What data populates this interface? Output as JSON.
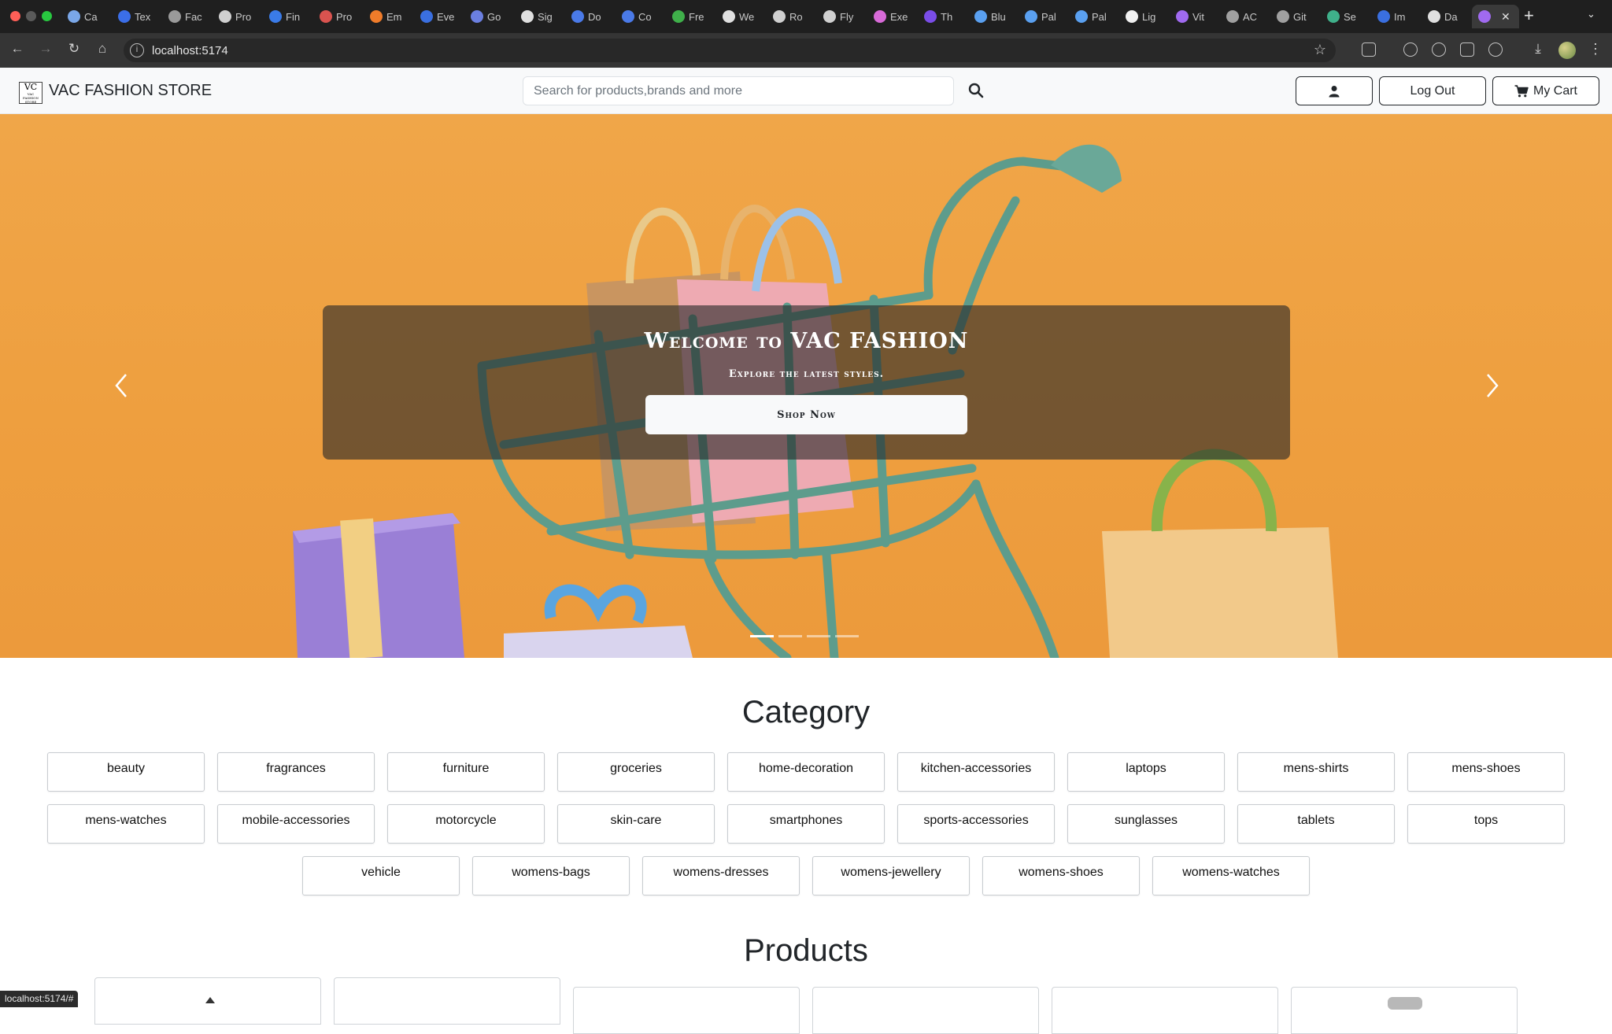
{
  "browser": {
    "tabs": [
      {
        "label": "Ca",
        "color": "#7aa7e8"
      },
      {
        "label": "Tex",
        "color": "#3b6ee8"
      },
      {
        "label": "Fac",
        "color": "#9a9a9a"
      },
      {
        "label": "Pro",
        "color": "#d0d0d0"
      },
      {
        "label": "Fin",
        "color": "#3a7be8"
      },
      {
        "label": "Pro",
        "color": "#d9534f"
      },
      {
        "label": "Em",
        "color": "#f07c2a"
      },
      {
        "label": "Eve",
        "color": "#3a6fe0"
      },
      {
        "label": "Go",
        "color": "#6b7fe0"
      },
      {
        "label": "Sig",
        "color": "#e0e0e0"
      },
      {
        "label": "Do",
        "color": "#4a7ae8"
      },
      {
        "label": "Co",
        "color": "#4a7ae8"
      },
      {
        "label": "Fre",
        "color": "#3fb04a"
      },
      {
        "label": "We",
        "color": "#e0e0e0"
      },
      {
        "label": "Ro",
        "color": "#d0d0d0"
      },
      {
        "label": "Fly",
        "color": "#d0d0d0"
      },
      {
        "label": "Exe",
        "color": "#d86ad8"
      },
      {
        "label": "Th",
        "color": "#7a4de8"
      },
      {
        "label": "Blu",
        "color": "#5aa0f0"
      },
      {
        "label": "Pal",
        "color": "#5aa0f0"
      },
      {
        "label": "Pal",
        "color": "#5aa0f0"
      },
      {
        "label": "Lig",
        "color": "#f0f0f0"
      },
      {
        "label": "Vit",
        "color": "#a06af0"
      },
      {
        "label": "AC",
        "color": "#a0a0a0"
      },
      {
        "label": "Git",
        "color": "#a0a0a0"
      },
      {
        "label": "Se",
        "color": "#3fb08a"
      },
      {
        "label": "Im",
        "color": "#3a6fe0"
      },
      {
        "label": "Da",
        "color": "#e0e0e0"
      }
    ],
    "active_tab_color": "#a06af0",
    "new_tab_label": "+",
    "url": "localhost:5174",
    "status_url": "localhost:5174/#"
  },
  "header": {
    "logo_text": "VC",
    "logo_subtext": "VAC FASHION STORE",
    "brand": "VAC FASHION STORE",
    "search_placeholder": "Search for products,brands and more",
    "logout_label": "Log Out",
    "cart_label": "My Cart"
  },
  "hero": {
    "title": "Welcome to VAC FASHION",
    "subtitle": "Explore the latest styles.",
    "cta_label": "Shop Now",
    "slide_count": 4,
    "active_slide": 1,
    "background_color": "#ee9f3f"
  },
  "category": {
    "title": "Category",
    "rows": [
      [
        "beauty",
        "fragrances",
        "furniture",
        "groceries",
        "home-decoration",
        "kitchen-accessories",
        "laptops",
        "mens-shirts",
        "mens-shoes"
      ],
      [
        "mens-watches",
        "mobile-accessories",
        "motorcycle",
        "skin-care",
        "smartphones",
        "sports-accessories",
        "sunglasses",
        "tablets",
        "tops"
      ],
      [
        "vehicle",
        "womens-bags",
        "womens-dresses",
        "womens-jewellery",
        "womens-shoes",
        "womens-watches"
      ]
    ]
  },
  "products": {
    "title": "Products"
  }
}
